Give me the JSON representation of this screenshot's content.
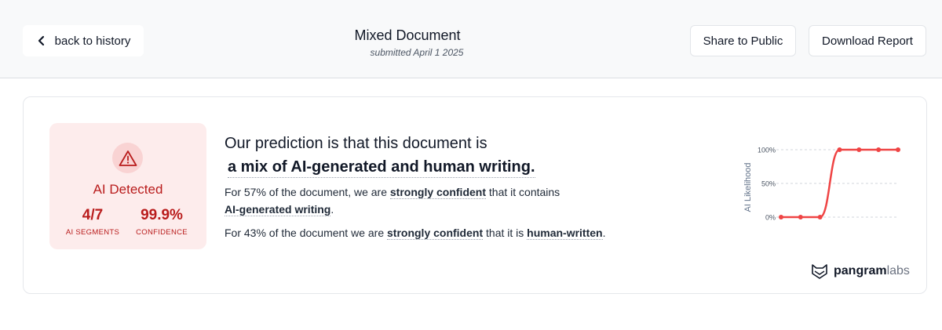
{
  "header": {
    "back_label": "back to history",
    "title": "Mixed Document",
    "subtitle": "submitted April 1 2025",
    "share_label": "Share to Public",
    "download_label": "Download Report"
  },
  "result": {
    "status": "AI Detected",
    "segments_value": "4/7",
    "segments_label": "AI SEGMENTS",
    "confidence_value": "99.9%",
    "confidence_label": "CONFIDENCE",
    "status_color": "#b91c1c"
  },
  "prediction": {
    "intro": "Our prediction is that this document is",
    "verdict": "a mix of AI-generated and human writing.",
    "line1_a": "For 57% of the document, we are ",
    "line1_b": "strongly confident",
    "line1_c": " that it contains ",
    "line1_d": "AI-generated writing",
    "line1_e": ".",
    "line2_a": "For 43% of the document we are ",
    "line2_b": "strongly confident",
    "line2_c": " that it is ",
    "line2_d": "human-written",
    "line2_e": "."
  },
  "brand": {
    "name_bold": "pangram",
    "name_light": "labs"
  },
  "chart_data": {
    "type": "line",
    "ylabel": "AI Likelihood",
    "xlabel": "",
    "title": "",
    "ylim": [
      0,
      100
    ],
    "yticks": [
      "0%",
      "50%",
      "100%"
    ],
    "x": [
      1,
      2,
      3,
      4,
      5,
      6,
      7
    ],
    "series": [
      {
        "values": [
          0,
          0,
          0,
          100,
          100,
          100,
          100
        ],
        "color": "#ef4444"
      }
    ],
    "grid": true
  }
}
